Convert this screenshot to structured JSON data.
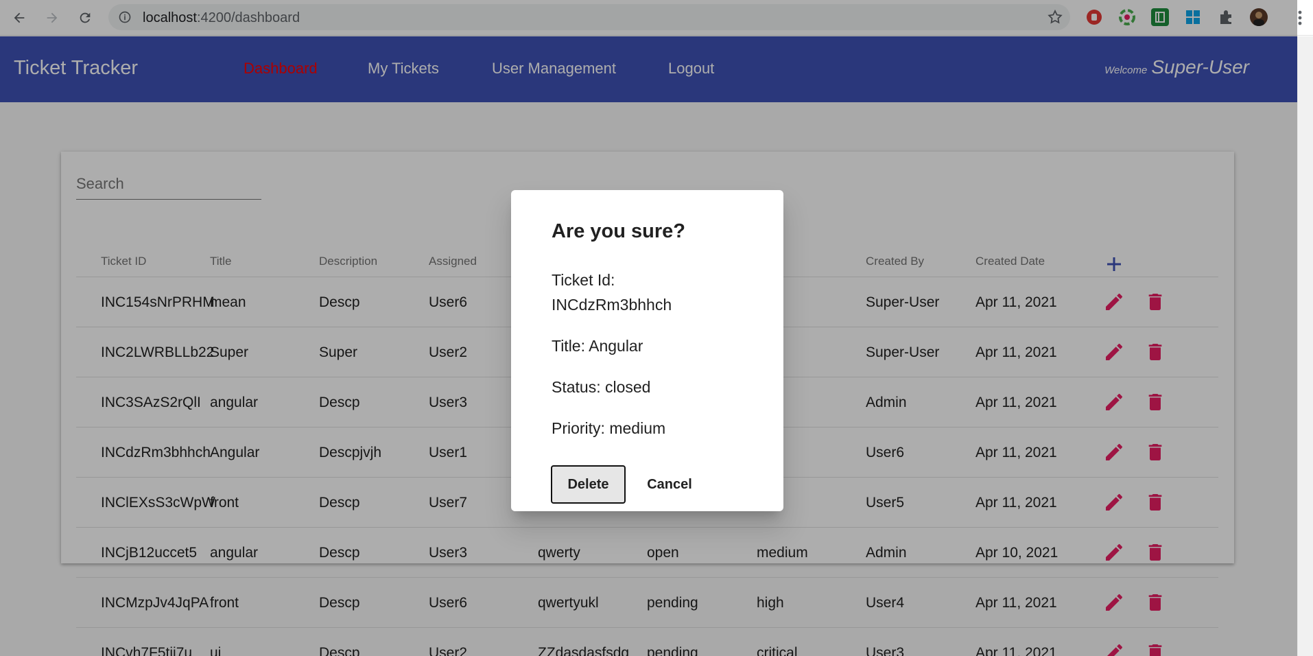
{
  "browser": {
    "url_host": "localhost",
    "url_path": ":4200/dashboard"
  },
  "app": {
    "brand": "Ticket Tracker",
    "nav": {
      "dashboard": "Dashboard",
      "my_tickets": "My Tickets",
      "user_management": "User Management",
      "logout": "Logout"
    },
    "welcome_label": "Welcome",
    "username": "Super-User",
    "active_nav_color": "#ff0000",
    "header_color": "#3f51b5",
    "action_color": "#e91e63"
  },
  "search": {
    "placeholder": "Search"
  },
  "table": {
    "headers": {
      "ticket_id": "Ticket ID",
      "title": "Title",
      "description": "Description",
      "assigned": "Assigned",
      "assignee_name": "",
      "status": "",
      "priority": "ity",
      "created_by": "Created By",
      "created_date": "Created Date"
    },
    "rows": [
      {
        "id": "INC154sNrPRHM",
        "title": "mean",
        "desc": "Descp",
        "assigned": "User6",
        "col5": "",
        "status": "",
        "priority": "cal",
        "created_by": "Super-User",
        "date": "Apr 11, 2021"
      },
      {
        "id": "INC2LWRBLLb22",
        "title": "Super",
        "desc": "Super",
        "assigned": "User2",
        "col5": "",
        "status": "",
        "priority": "cal",
        "created_by": "Super-User",
        "date": "Apr 11, 2021"
      },
      {
        "id": "INC3SAzS2rQlI",
        "title": "angular",
        "desc": "Descp",
        "assigned": "User3",
        "col5": "",
        "status": "",
        "priority": "",
        "created_by": "Admin",
        "date": "Apr 11, 2021"
      },
      {
        "id": "INCdzRm3bhhch",
        "title": "Angular",
        "desc": "Descpjvjh",
        "assigned": "User1",
        "col5": "",
        "status": "",
        "priority": "lium",
        "created_by": "User6",
        "date": "Apr 11, 2021"
      },
      {
        "id": "INClEXsS3cWpW",
        "title": "front",
        "desc": "Descp",
        "assigned": "User7",
        "col5": "",
        "status": "",
        "priority": "",
        "created_by": "User5",
        "date": "Apr 11, 2021"
      },
      {
        "id": "INCjB12uccet5",
        "title": "angular",
        "desc": "Descp",
        "assigned": "User3",
        "col5": "qwerty",
        "status": "open",
        "priority": "medium",
        "created_by": "Admin",
        "date": "Apr 10, 2021"
      },
      {
        "id": "INCMzpJv4JqPA",
        "title": "front",
        "desc": "Descp",
        "assigned": "User6",
        "col5": "qwertyukl",
        "status": "pending",
        "priority": "high",
        "created_by": "User4",
        "date": "Apr 11, 2021"
      },
      {
        "id": "INCvh7F5tij7u",
        "title": "ui",
        "desc": "Descp",
        "assigned": "User2",
        "col5": "ZZdasdasfsdg",
        "status": "pending",
        "priority": "critical",
        "created_by": "User3",
        "date": "Apr 11, 2021"
      }
    ]
  },
  "dialog": {
    "title": "Are you sure?",
    "ticket_id_label": "Ticket Id:",
    "ticket_id_value": "INCdzRm3bhhch",
    "title_line": "Title: Angular",
    "status_line": "Status: closed",
    "priority_line": "Priority: medium",
    "delete_label": "Delete",
    "cancel_label": "Cancel"
  }
}
